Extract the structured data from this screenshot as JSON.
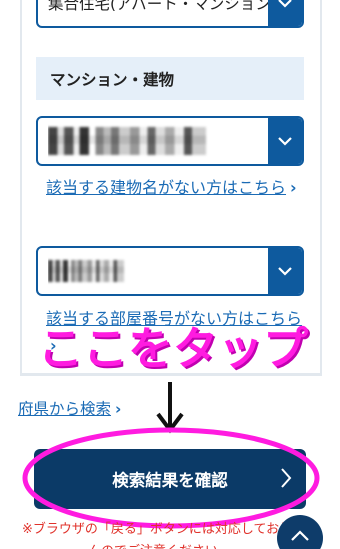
{
  "form": {
    "housing_type_value": "集合住宅(アパート・マンション",
    "building_section_title": "マンション・建物",
    "building_select_value": "",
    "building_link": "該当する建物名がない方はこちら",
    "room_select_value": "",
    "room_link": "該当する部屋番号がない方はこちら"
  },
  "nav": {
    "prefecture_search_link": "府県から検索"
  },
  "actions": {
    "confirm_label": "検索結果を確認"
  },
  "notes": {
    "back_button_warning": "※ブラウザの「戻る」ボタンには対応しておりま",
    "back_button_warning_2": "んのでご注意ください"
  },
  "annotation": {
    "tap_here_text": "ここをタップ",
    "color": "#ff1be0"
  },
  "colors": {
    "primary": "#0e5a9e",
    "button_dark": "#0b3a67",
    "link": "#1b6bb5",
    "warning": "#e0322b",
    "section_bg": "#e5eff9"
  }
}
